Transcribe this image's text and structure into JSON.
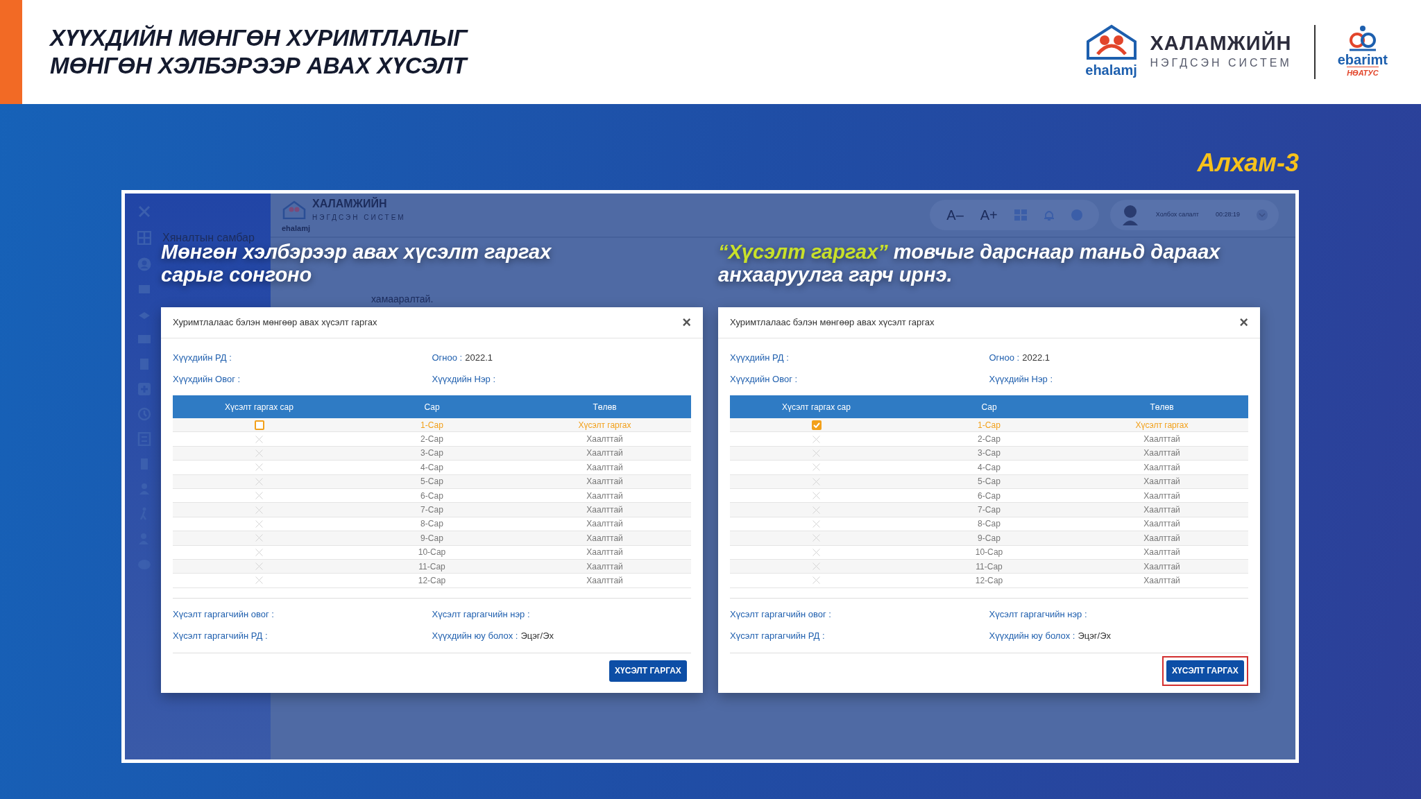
{
  "slide": {
    "title_lines": [
      "ХҮҮХДИЙН МӨНГӨН ХУРИМТЛАЛЫГ",
      "МӨНГӨН ХЭЛБЭРЭЭР АВАХ ХҮСЭЛТ"
    ],
    "brand": {
      "logo_text": "ehalamj",
      "name": "ХАЛАМЖИЙН",
      "subtitle": "НЭГДСЭН СИСТЕМ",
      "ebarimt": "ebarimt",
      "ebarimt_sub": "НӨАТУС"
    },
    "step": "Алхам-3"
  },
  "app": {
    "logo_text": "ehalamj",
    "name": "ХАЛАМЖИЙН",
    "subtitle": "НЭГДСЭН СИСТЕМ",
    "font_buttons": [
      "A–",
      "A+"
    ],
    "user": {
      "name": "Холбох салалт",
      "time": "00:28:19"
    },
    "sidebar_item": "Хяналтын самбар",
    "background_text": "хамааралтай."
  },
  "panels": [
    {
      "caption": {
        "text": "Мөнгөн хэлбэрээр авах хүсэлт гаргах сарыг сонгоно"
      },
      "dialog": {
        "title": "Хуримтлалаас бэлэн мөнгөөр авах хүсэлт гаргах",
        "close": "×",
        "fields": [
          {
            "label": "Хүүхдийн РД :"
          },
          {
            "label": "Огноо :",
            "value": "2022.1"
          },
          {
            "label": "Хүүхдийн Овог :"
          },
          {
            "label": "Хүүхдийн Нэр :"
          }
        ],
        "columns": [
          "Хүсэлт гаргах сар",
          "Сар",
          "Төлөв"
        ],
        "rows": [
          {
            "kind": "open",
            "checked": false,
            "month": "1-Сар",
            "status": "Хүсэлт гаргах"
          },
          {
            "kind": "closed",
            "month": "2-Сар",
            "status": "Хаалттай"
          },
          {
            "kind": "closed",
            "month": "3-Сар",
            "status": "Хаалттай"
          },
          {
            "kind": "closed",
            "month": "4-Сар",
            "status": "Хаалттай"
          },
          {
            "kind": "closed",
            "month": "5-Сар",
            "status": "Хаалттай"
          },
          {
            "kind": "closed",
            "month": "6-Сар",
            "status": "Хаалттай"
          },
          {
            "kind": "closed",
            "month": "7-Сар",
            "status": "Хаалттай"
          },
          {
            "kind": "closed",
            "month": "8-Сар",
            "status": "Хаалттай"
          },
          {
            "kind": "closed",
            "month": "9-Сар",
            "status": "Хаалттай"
          },
          {
            "kind": "closed",
            "month": "10-Сар",
            "status": "Хаалттай"
          },
          {
            "kind": "closed",
            "month": "11-Сар",
            "status": "Хаалттай"
          },
          {
            "kind": "closed",
            "month": "12-Сар",
            "status": "Хаалттай"
          }
        ],
        "footer_fields": [
          {
            "label": "Хүсэлт гаргагчийн овог :"
          },
          {
            "label": "Хүсэлт гаргагчийн нэр :"
          },
          {
            "label": "Хүсэлт гаргагчийн РД :"
          },
          {
            "label": "Хүүхдийн юу болох :",
            "value": "Эцэг/Эх"
          }
        ],
        "button": {
          "label": "ХҮСЭЛТ ГАРГАХ"
        }
      }
    },
    {
      "caption": {
        "highlight": "“Хүсэлт гаргах”",
        "text": " товчыг дарснаар таньд дараах анхааруулга гарч ирнэ."
      },
      "dialog": {
        "title": "Хуримтлалаас бэлэн мөнгөөр авах хүсэлт гаргах",
        "close": "×",
        "fields": [
          {
            "label": "Хүүхдийн РД :"
          },
          {
            "label": "Огноо :",
            "value": "2022.1"
          },
          {
            "label": "Хүүхдийн Овог :"
          },
          {
            "label": "Хүүхдийн Нэр :"
          }
        ],
        "columns": [
          "Хүсэлт гаргах сар",
          "Сар",
          "Төлөв"
        ],
        "rows": [
          {
            "kind": "open",
            "checked": true,
            "month": "1-Сар",
            "status": "Хүсэлт гаргах"
          },
          {
            "kind": "closed",
            "month": "2-Сар",
            "status": "Хаалттай"
          },
          {
            "kind": "closed",
            "month": "3-Сар",
            "status": "Хаалттай"
          },
          {
            "kind": "closed",
            "month": "4-Сар",
            "status": "Хаалттай"
          },
          {
            "kind": "closed",
            "month": "5-Сар",
            "status": "Хаалттай"
          },
          {
            "kind": "closed",
            "month": "6-Сар",
            "status": "Хаалттай"
          },
          {
            "kind": "closed",
            "month": "7-Сар",
            "status": "Хаалттай"
          },
          {
            "kind": "closed",
            "month": "8-Сар",
            "status": "Хаалттай"
          },
          {
            "kind": "closed",
            "month": "9-Сар",
            "status": "Хаалттай"
          },
          {
            "kind": "closed",
            "month": "10-Сар",
            "status": "Хаалттай"
          },
          {
            "kind": "closed",
            "month": "11-Сар",
            "status": "Хаалттай"
          },
          {
            "kind": "closed",
            "month": "12-Сар",
            "status": "Хаалттай"
          }
        ],
        "footer_fields": [
          {
            "label": "Хүсэлт гаргагчийн овог :"
          },
          {
            "label": "Хүсэлт гаргагчийн нэр :"
          },
          {
            "label": "Хүсэлт гаргагчийн РД :"
          },
          {
            "label": "Хүүхдийн юу болох :",
            "value": "Эцэг/Эх"
          }
        ],
        "button": {
          "label": "ХҮСЭЛТ ГАРГАХ",
          "highlighted": true
        }
      }
    }
  ]
}
